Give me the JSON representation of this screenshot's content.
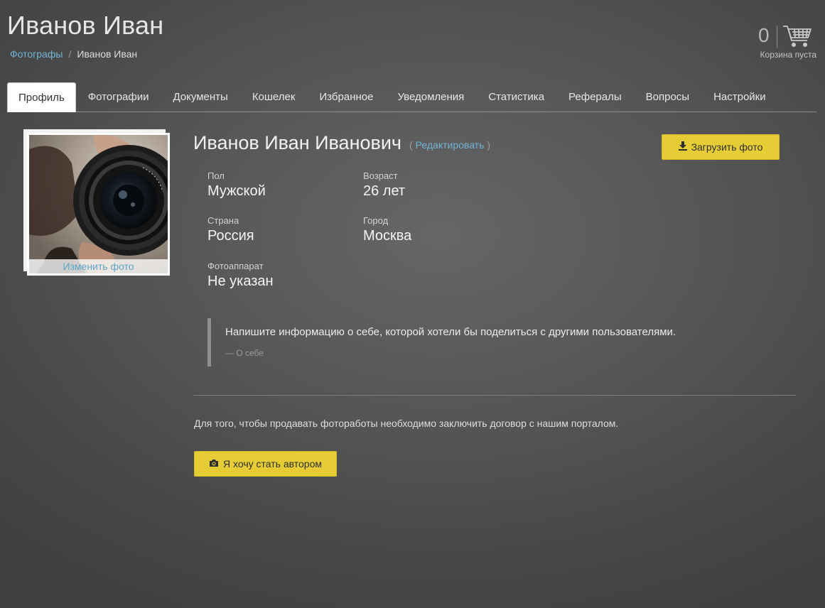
{
  "header": {
    "title": "Иванов Иван",
    "breadcrumb": {
      "parent": "Фотографы",
      "separator": "/",
      "current": "Иванов Иван"
    }
  },
  "cart": {
    "count": "0",
    "status": "Корзина пуста",
    "icon": "shopping-cart-icon"
  },
  "tabs": [
    {
      "label": "Профиль",
      "active": true
    },
    {
      "label": "Фотографии"
    },
    {
      "label": "Документы"
    },
    {
      "label": "Кошелек"
    },
    {
      "label": "Избранное"
    },
    {
      "label": "Уведомления"
    },
    {
      "label": "Статистика"
    },
    {
      "label": "Рефералы"
    },
    {
      "label": "Вопросы"
    },
    {
      "label": "Настройки"
    }
  ],
  "profile": {
    "photo_caption": "Изменить фото",
    "full_name": "Иванов Иван Иванович",
    "edit_open": "(",
    "edit_label": "Редактировать",
    "edit_close": ")",
    "upload_label": "Загрузить фото",
    "fields": {
      "gender": {
        "label": "Пол",
        "value": "Мужской"
      },
      "age": {
        "label": "Возраст",
        "value": "26 лет"
      },
      "country": {
        "label": "Страна",
        "value": "Россия"
      },
      "city": {
        "label": "Город",
        "value": "Москва"
      },
      "camera": {
        "label": "Фотоаппарат",
        "value": "Не указан"
      }
    },
    "about": {
      "text": "Напишите информацию о себе, которой хотели бы поделиться с другими пользователями.",
      "source": "— О себе"
    }
  },
  "author": {
    "notice": "Для того, чтобы продавать фотоработы необходимо заключить договор с нашим порталом.",
    "button_label": "Я хочу стать автором"
  },
  "colors": {
    "accent_yellow": "#e6cd35",
    "link_blue": "#6fb4d6"
  }
}
